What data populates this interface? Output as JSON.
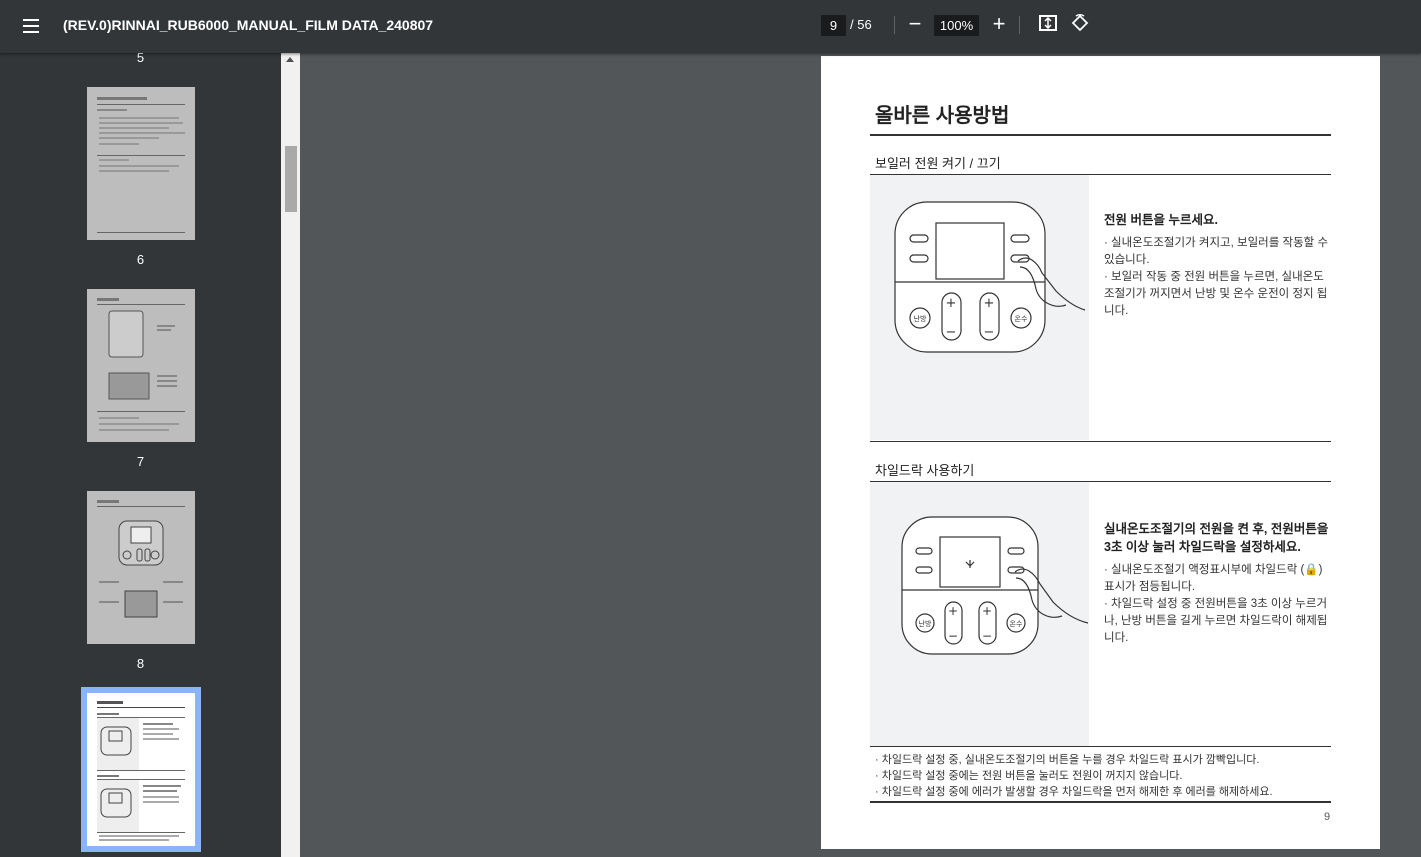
{
  "toolbar": {
    "title": "(REV.0)RINNAI_RUB6000_MANUAL_FILM DATA_240807",
    "current_page": "9",
    "total_pages": "/ 56",
    "zoom": "100%",
    "zoom_out_glyph": "−",
    "zoom_in_glyph": "+"
  },
  "sidebar": {
    "thumbnails": [
      {
        "label": "5"
      },
      {
        "label": "6"
      },
      {
        "label": "7"
      },
      {
        "label": "8"
      }
    ],
    "selected_page": "9"
  },
  "page": {
    "title": "올바른 사용방법",
    "section1": {
      "title": "보일러 전원 켜기 / 끄기",
      "heading": "전원 버튼을 누르세요.",
      "bullets": [
        "· 실내온도조절기가 켜지고, 보일러를 작동할 수 있습니다.",
        "· 보일러 작동 중 전원 버튼을 누르면, 실내온도 조절기가 꺼지면서 난방 및 온수 운전이 정지 됩니다."
      ]
    },
    "section2": {
      "title": "차일드락 사용하기",
      "heading": "실내온도조절기의 전원을 켠 후, 전원버튼을 3초 이상 눌러 차일드락을 설정하세요.",
      "bullets": [
        "· 실내온도조절기 액정표시부에 차일드락 (🔒) 표시가 점등됩니다.",
        "· 차일드락 설정 중 전원버튼을 3초 이상 누르거나, 난방 버튼을 길게 누르면 차일드락이 해제됩니다."
      ]
    },
    "notes": [
      "· 차일드락 설정 중, 실내온도조절기의 버튼을 누를 경우 차일드락 표시가 깜빡입니다.",
      "· 차일드락 설정 중에는 전원 버튼을 눌러도 전원이 꺼지지 않습니다.",
      "· 차일드락 설정 중에 에러가 발생할 경우 차일드락을 먼저 해제한 후 에러를 해제하세요."
    ],
    "page_number": "9",
    "device": {
      "heat_button": "난방",
      "hot_water_button": "온수",
      "plus": "+",
      "minus": "−"
    }
  },
  "colors": {
    "toolbar": "#323639",
    "viewer_bg": "#525659",
    "selected_thumb": "#8ab4f8",
    "illustration_bg": "#f1f2f3"
  }
}
